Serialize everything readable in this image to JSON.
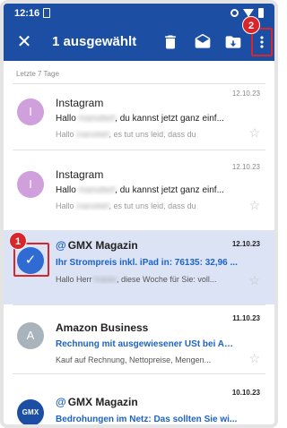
{
  "status_bar": {
    "time": "12:16"
  },
  "toolbar": {
    "close_icon": "close-icon",
    "title": "1 ausgewählt",
    "actions": [
      "delete-icon",
      "mark-read-icon",
      "move-to-folder-icon",
      "more-vert-icon"
    ]
  },
  "annotations": {
    "step1": "1",
    "step2": "2",
    "highlight_color": "#d8262b"
  },
  "section": {
    "label": "Letzte 7 Tage"
  },
  "colors": {
    "brand": "#1c4fa3",
    "accent": "#2f6bd2",
    "selected_bg": "#dbe3f4",
    "link_blue": "#1c63c6"
  },
  "mails": [
    {
      "sender": "Instagram",
      "avatar": "I",
      "avatar_color": "#cfa0dc",
      "date": "12.10.23",
      "subject_pre": "Hallo ",
      "subject_blur": "manubeil",
      "subject_post": ", du kannst jetzt ganz einf...",
      "preview_pre": "Hallo ",
      "preview_blur": "manubeil",
      "preview_post": ", es tut uns leid, dass du"
    },
    {
      "sender": "Instagram",
      "avatar": "I",
      "avatar_color": "#cfa0dc",
      "date": "12.10.23",
      "subject_pre": "Hallo ",
      "subject_blur": "manubeil",
      "subject_post": ", du kannst jetzt ganz einf...",
      "preview_pre": "Hallo ",
      "preview_blur": "manubeil",
      "preview_post": ", es tut uns leid, dass du"
    },
    {
      "sender": "GMX Magazin",
      "sender_prefix": "@",
      "date": "12.10.23",
      "subject": "Ihr Strompreis inkl. iPad in: 76135: 32,96 ...",
      "preview_pre": "Hallo Herr ",
      "preview_blur": "Kaiser",
      "preview_post": ", diese Woche für Sie: voll..."
    },
    {
      "sender": "Amazon Business",
      "avatar": "A",
      "avatar_color": "#a9b3bc",
      "date": "11.10.23",
      "subject": "Rechnung mit ausgewiesener USt bei Am...",
      "preview": "Kauf auf Rechnung, Nettopreise, Mengen..."
    },
    {
      "sender": "GMX Magazin",
      "sender_prefix": "@",
      "avatar": "GMX",
      "date": "10.10.23",
      "subject": "Bedrohungen im Netz: Das sollten Sie wi..."
    }
  ]
}
